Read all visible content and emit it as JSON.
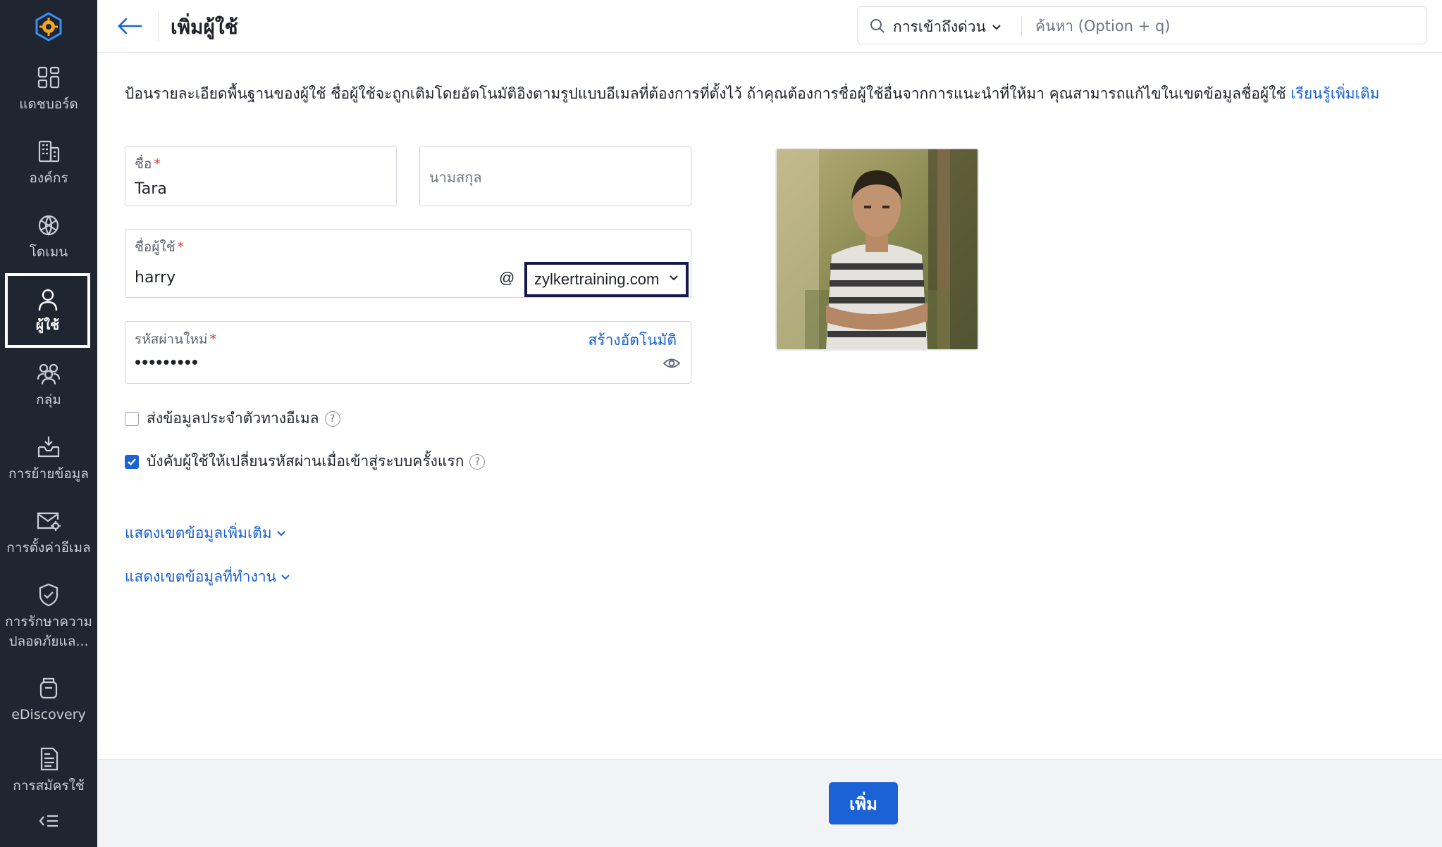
{
  "sidebar": {
    "items": [
      {
        "label": "แดชบอร์ด",
        "icon": "dashboard-icon"
      },
      {
        "label": "องค์กร",
        "icon": "organization-icon"
      },
      {
        "label": "โดเมน",
        "icon": "domain-icon"
      },
      {
        "label": "ผู้ใช้",
        "icon": "user-icon",
        "active": true
      },
      {
        "label": "กลุ่ม",
        "icon": "group-icon"
      },
      {
        "label": "การย้ายข้อมูล",
        "icon": "migration-icon"
      },
      {
        "label": "การตั้งค่าอีเมล",
        "icon": "mail-settings-icon"
      },
      {
        "label": "การรักษาความปลอดภัยแล...",
        "line1": "การรักษาความ",
        "line2": "ปลอดภัยแล...",
        "icon": "security-shield-icon"
      },
      {
        "label": "eDiscovery",
        "icon": "ediscovery-icon"
      },
      {
        "label": "การสมัครใช้",
        "icon": "subscription-icon"
      }
    ],
    "collapse_icon": "collapse-icon"
  },
  "header": {
    "title": "เพิ่มผู้ใช้",
    "quick_access": "การเข้าถึงด่วน",
    "search_placeholder": "ค้นหา (Option + q)"
  },
  "intro": {
    "text": "ป้อนรายละเอียดพื้นฐานของผู้ใช้ ชื่อผู้ใช้จะถูกเติมโดยอัตโนมัติอิงตามรูปแบบอีเมลที่ต้องการที่ตั้งไว้ ถ้าคุณต้องการชื่อผู้ใช้อื่นจากการแนะนำที่ให้มา คุณสามารถแก้ไขในเขตข้อมูลชื่อผู้ใช้",
    "learn_more": "เรียนรู้เพิ่มเติม"
  },
  "form": {
    "first_name": {
      "label": "ชื่อ",
      "required": "*",
      "value": "Tara"
    },
    "last_name": {
      "placeholder": "นามสกุล"
    },
    "username": {
      "label": "ชื่อผู้ใช้",
      "required": "*",
      "value": "harry",
      "at": "@",
      "domain": "zylkertraining.com"
    },
    "password": {
      "label": "รหัสผ่านใหม่",
      "required": "*",
      "value": "•••••••••",
      "auto_generate": "สร้างอัตโนมัติ"
    },
    "send_email": {
      "label": "ส่งข้อมูลประจำตัวทางอีเมล",
      "checked": false
    },
    "force_change": {
      "label": "บังคับผู้ใช้ให้เปลี่ยนรหัสผ่านเมื่อเข้าสู่ระบบครั้งแรก",
      "checked": true
    },
    "show_more_fields": "แสดงเขตข้อมูลเพิ่มเติม",
    "show_work_fields": "แสดงเขตข้อมูลที่ทำงาน"
  },
  "footer": {
    "add_button": "เพิ่ม"
  },
  "colors": {
    "sidebar_bg": "#1f2632",
    "accent": "#1a62d6",
    "domain_border": "#141a4f"
  }
}
